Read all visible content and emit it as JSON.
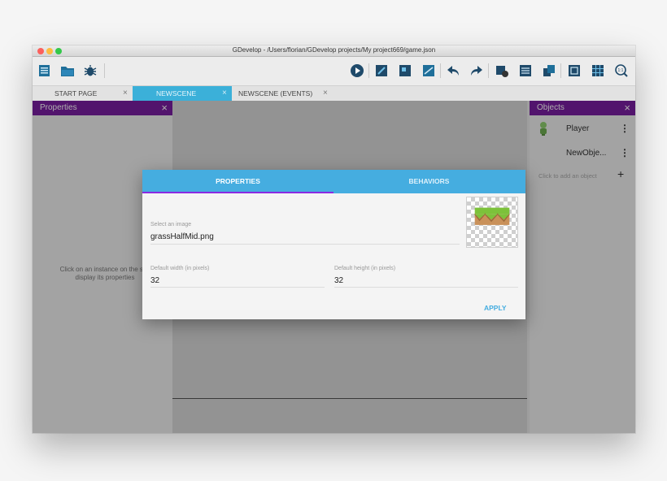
{
  "window": {
    "title": "GDevelop - /Users/florian/GDevelop projects/My project669/game.json"
  },
  "toolbar": {
    "icons": [
      "project-manager-icon",
      "open-folder-icon",
      "debugger-icon",
      "preview-play-icon",
      "scene-properties-icon",
      "layer-editor-icon",
      "instances-list-icon",
      "undo-icon",
      "redo-icon",
      "object-groups-icon",
      "events-sheet-icon",
      "objects-list-icon",
      "window-mask-icon",
      "grid-icon",
      "zoom-reset-icon"
    ],
    "zoom_label": "1:1"
  },
  "tabs": [
    {
      "label": "START PAGE",
      "active": false
    },
    {
      "label": "NEWSCENE",
      "active": true
    },
    {
      "label": "NEWSCENE (EVENTS)",
      "active": false
    }
  ],
  "tab_close": "×",
  "left_panel": {
    "title": "Properties",
    "close": "×",
    "hint_line1": "Click on an instance on the sce",
    "hint_line2": "display its properties"
  },
  "right_panel": {
    "title": "Objects",
    "close": "×",
    "objects": [
      {
        "name": "Player",
        "icon": "player-sprite-icon"
      },
      {
        "name": "NewObje...",
        "icon": ""
      }
    ],
    "kebab": "⋮",
    "add_hint": "Click to add an object",
    "add_symbol": "+"
  },
  "dialog": {
    "tabs": [
      "PROPERTIES",
      "BEHAVIORS"
    ],
    "image_label": "Select an image",
    "image_value": "grassHalfMid.png",
    "width_label": "Default width (in pixels)",
    "width_value": "32",
    "height_label": "Default height (in pixels)",
    "height_value": "32",
    "apply_label": "APPLY"
  },
  "colors": {
    "accent": "#3bb0d9",
    "panel_header": "#7a1ea1",
    "dialog_tab": "#45ade0",
    "tab_indicator": "#8a2be2"
  }
}
